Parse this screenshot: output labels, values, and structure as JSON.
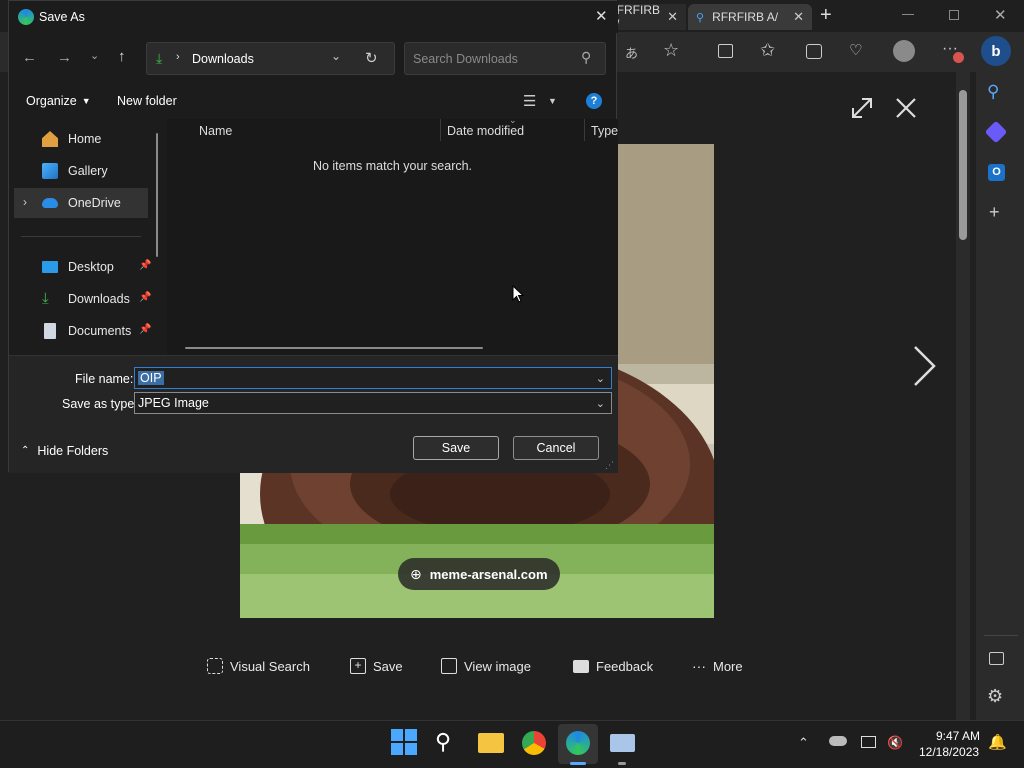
{
  "browser": {
    "tabs": [
      {
        "label": "RFRFIRB A/"
      },
      {
        "label": "RFRFIRB A/"
      }
    ],
    "new_tab": "+"
  },
  "viewer": {
    "watermark": "meme-arsenal.com",
    "actions": [
      {
        "label": "Visual Search",
        "icon": "visual-search-icon"
      },
      {
        "label": "Save",
        "icon": "save-icon"
      },
      {
        "label": "View image",
        "icon": "view-image-icon"
      },
      {
        "label": "Feedback",
        "icon": "feedback-icon"
      },
      {
        "label": "More",
        "icon": "more-icon"
      }
    ]
  },
  "dialog": {
    "title": "Save As",
    "address": "Downloads",
    "search_placeholder": "Search Downloads",
    "organize": "Organize",
    "new_folder": "New folder",
    "nav": {
      "home": "Home",
      "gallery": "Gallery",
      "onedrive": "OneDrive",
      "desktop": "Desktop",
      "downloads": "Downloads",
      "documents": "Documents"
    },
    "columns": {
      "name": "Name",
      "date": "Date modified",
      "type": "Type"
    },
    "empty": "No items match your search.",
    "filename_label": "File name:",
    "filename_value": "OIP",
    "savetype_label": "Save as type:",
    "savetype_value": "JPEG Image",
    "hide_folders": "Hide Folders",
    "save": "Save",
    "cancel": "Cancel"
  },
  "taskbar": {
    "time": "9:47 AM",
    "date": "12/18/2023"
  },
  "colors": {
    "accent": "#0a84ff",
    "selection": "#3a6ea5",
    "edge_blue": "#1e88e5"
  }
}
